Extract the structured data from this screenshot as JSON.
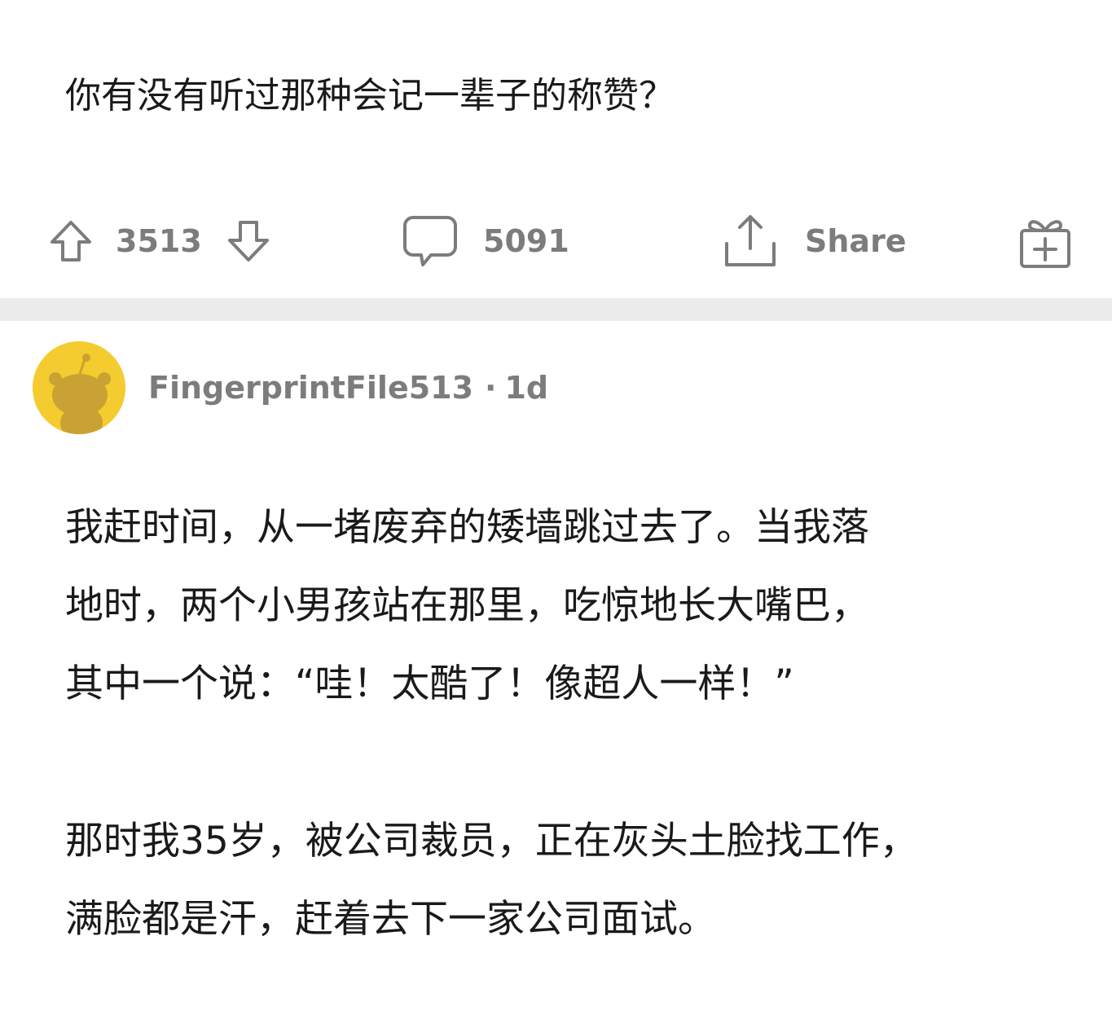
{
  "post": {
    "title": "你有没有听过那种会记一辈子的称赞？",
    "actions": {
      "upvote_icon": "upvote-arrow-icon",
      "vote_count": "3513",
      "downvote_icon": "downvote-arrow-icon",
      "comment_icon": "comment-bubble-icon",
      "comment_count": "5091",
      "share_icon": "share-upload-icon",
      "share_label": "Share",
      "award_icon": "gift-award-icon"
    }
  },
  "comment": {
    "avatar_icon": "snoo-avatar-icon",
    "avatar_color": "#f4cc2f",
    "username": "FingerprintFile513",
    "separator": "·",
    "time": "1d",
    "paragraphs": [
      "我赶时间，从一堵废弃的矮墙跳过去了。当我落\n地时，两个小男孩站在那里，吃惊地长大嘴巴，\n其中一个说：“哇！太酷了！像超人一样！”",
      "那时我35岁，被公司裁员，正在灰头土脸找工作，\n满脸都是汗，赶着去下一家公司面试。"
    ]
  }
}
